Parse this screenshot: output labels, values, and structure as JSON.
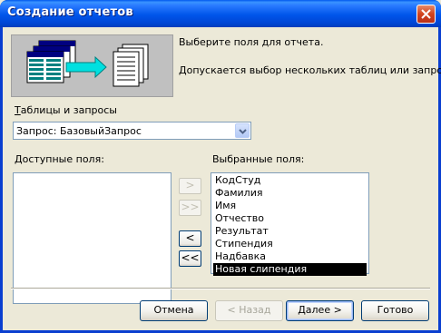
{
  "window": {
    "title": "Создание отчетов"
  },
  "intro": {
    "line1": "Выберите поля для отчета.",
    "line2": "Допускается выбор нескольких таблиц или запросов."
  },
  "source": {
    "label": "Таблицы и запросы",
    "selected": "Запрос: БазовыйЗапрос"
  },
  "available": {
    "label": "Доступные поля:",
    "items": []
  },
  "selected_fields": {
    "label": "Выбранные поля:",
    "items": [
      "КодСтуд",
      "Фамилия",
      "Имя",
      "Отчество",
      "Результат",
      "Стипендия",
      "Надбавка",
      "Новая слипендия"
    ],
    "highlighted": "Новая слипендия"
  },
  "move_buttons": {
    "add": ">",
    "add_all": ">>",
    "remove": "<",
    "remove_all": "<<"
  },
  "footer": {
    "cancel": "Отмена",
    "back": "< Назад",
    "next": "Далее >",
    "finish": "Готово"
  },
  "colors": {
    "titlebar": "#0055ea",
    "dialog_bg": "#ece9d8",
    "selection": "#000000"
  }
}
